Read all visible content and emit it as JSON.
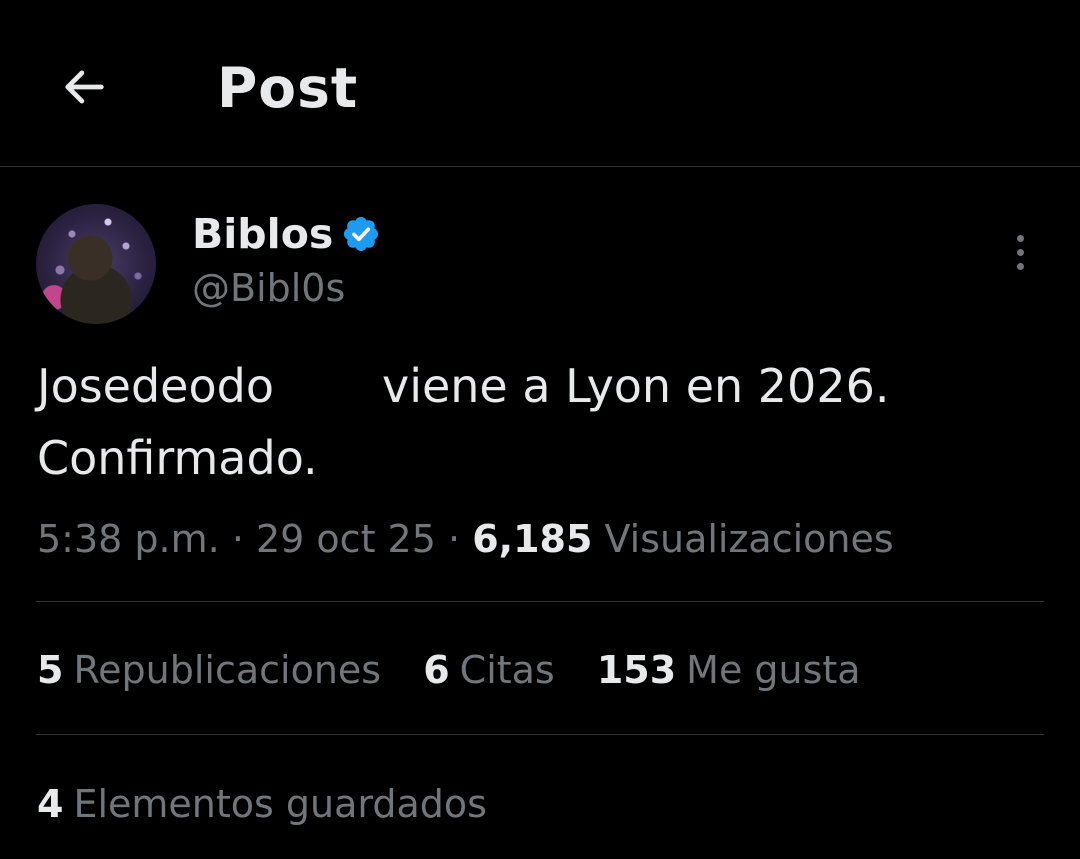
{
  "header": {
    "title": "Post",
    "back_icon": "arrow-left-icon"
  },
  "post": {
    "author": {
      "name": "Biblos",
      "handle": "@Bibl0s",
      "verified": true,
      "verified_color": "#1d9bf0"
    },
    "text_part1": "Josedeodo",
    "text_part2": "viene a Lyon en 2026.",
    "text_part3": "Confirmado.",
    "time": "5:38 p.m.",
    "date": "29 oct 25",
    "separator": "·",
    "views_count": "6,185",
    "views_label": "Visualizaciones"
  },
  "stats": {
    "reposts_count": "5",
    "reposts_label": "Republicaciones",
    "quotes_count": "6",
    "quotes_label": "Citas",
    "likes_count": "153",
    "likes_label": "Me gusta",
    "bookmarks_count": "4",
    "bookmarks_label": "Elementos guardados"
  },
  "colors": {
    "background": "#000000",
    "text_primary": "#e7e9ea",
    "text_secondary": "#71767b",
    "divider": "#2f3336",
    "accent": "#1d9bf0"
  }
}
